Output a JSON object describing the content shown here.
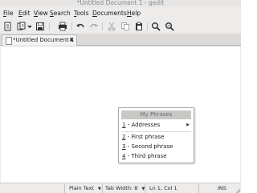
{
  "window": {
    "title": "*Untitled Document 1 - gedit"
  },
  "menubar": {
    "items": [
      {
        "label": "File",
        "mnemonic": "F"
      },
      {
        "label": "Edit",
        "mnemonic": "E"
      },
      {
        "label": "View",
        "mnemonic": "V"
      },
      {
        "label": "Search",
        "mnemonic": "S"
      },
      {
        "label": "Tools",
        "mnemonic": "T"
      },
      {
        "label": "Documents",
        "mnemonic": "D"
      },
      {
        "label": "Help",
        "mnemonic": "H"
      }
    ]
  },
  "toolbar": {
    "icons": [
      "new-document-icon",
      "open-icon",
      "open-dropdown-icon",
      "save-icon",
      "print-icon",
      "undo-icon",
      "redo-icon",
      "cut-icon",
      "copy-icon",
      "paste-icon",
      "find-icon",
      "find-replace-icon"
    ]
  },
  "tabs": [
    {
      "label": "*Untitled Document 1",
      "close_glyph": "✖"
    }
  ],
  "popup": {
    "header": "My Phrases",
    "items": [
      {
        "num": "1",
        "label": " - Addresses",
        "submenu": true
      },
      {
        "num": "2",
        "label": " - First phrase",
        "submenu": false
      },
      {
        "num": "3",
        "label": " - Second phrase",
        "submenu": false
      },
      {
        "num": "4",
        "label": " - Third phrase",
        "submenu": false
      }
    ]
  },
  "statusbar": {
    "language": "Plain Text",
    "tab_width": "Tab Width:  8",
    "position": "Ln 1, Col 1",
    "mode": "INS"
  },
  "colors": {
    "chrome": "#edeceb",
    "editor_bg": "#ffffff",
    "popup_header": "#c8c7c5"
  }
}
